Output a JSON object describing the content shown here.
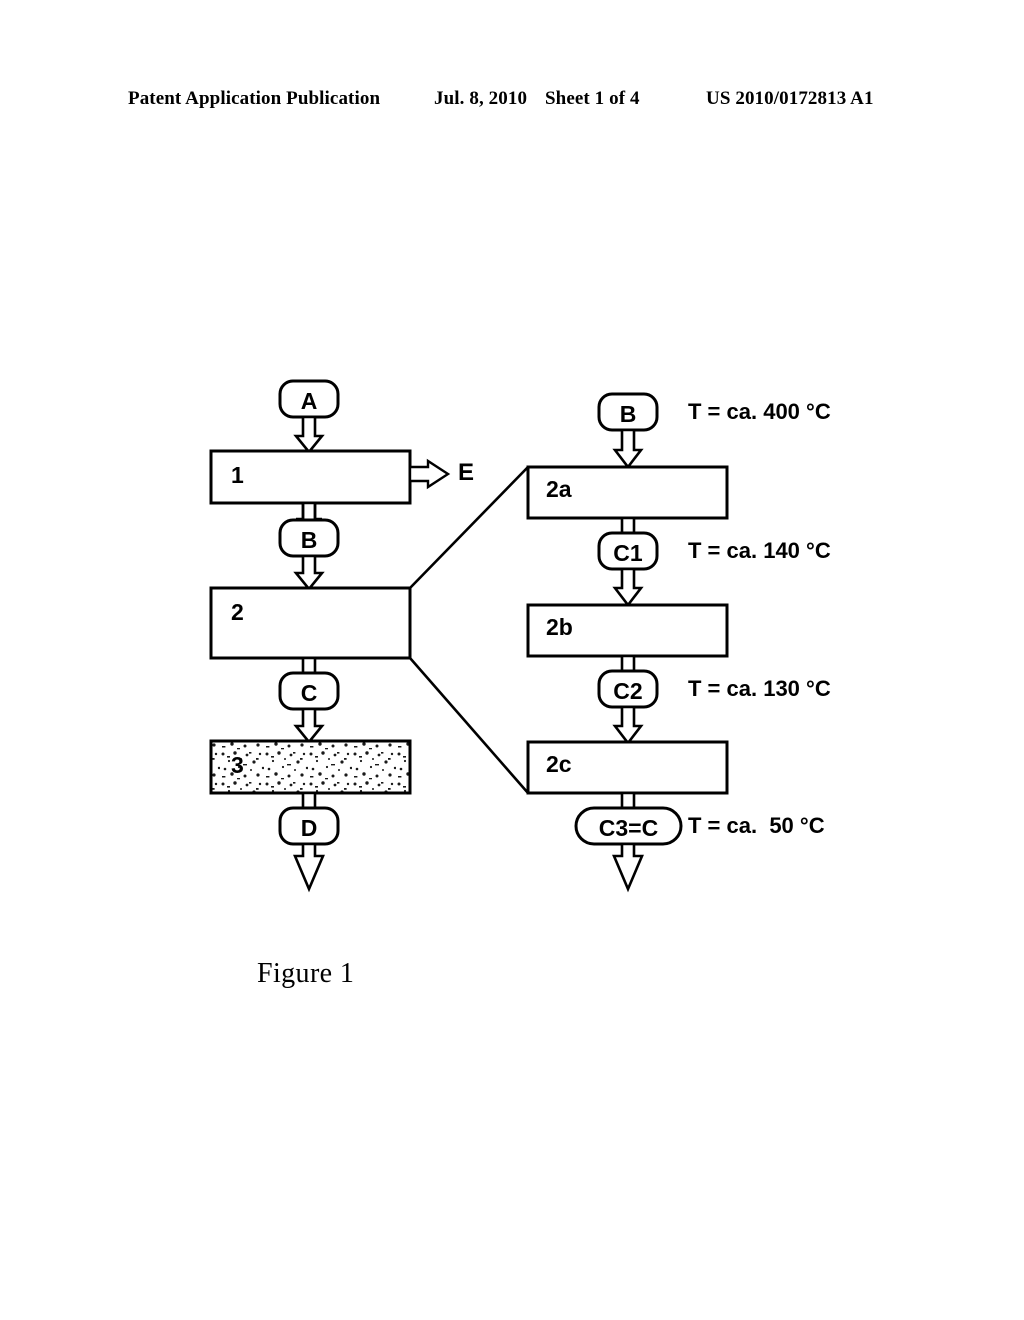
{
  "header": {
    "publication": "Patent Application Publication",
    "date": "Jul. 8, 2010",
    "sheet": "Sheet 1 of 4",
    "number": "US 2010/0172813 A1"
  },
  "figure": {
    "caption": "Figure 1",
    "left_column": {
      "nodes": [
        {
          "id": "A",
          "label": "A"
        },
        {
          "id": "B",
          "label": "B"
        },
        {
          "id": "C",
          "label": "C"
        },
        {
          "id": "D",
          "label": "D"
        }
      ],
      "boxes": [
        {
          "id": "1",
          "label": "1",
          "fill": "white"
        },
        {
          "id": "2",
          "label": "2",
          "fill": "white"
        },
        {
          "id": "3",
          "label": "3",
          "fill": "stippled"
        }
      ],
      "side_stream": {
        "label": "E"
      }
    },
    "right_column": {
      "nodes": [
        {
          "id": "B",
          "label": "B",
          "temperature": "T = ca. 400 °C"
        },
        {
          "id": "C1",
          "label": "C1",
          "temperature": "T = ca. 140 °C"
        },
        {
          "id": "C2",
          "label": "C2",
          "temperature": "T = ca. 130 °C"
        },
        {
          "id": "C3",
          "label": "C3=C",
          "temperature": "T = ca.  50 °C"
        }
      ],
      "boxes": [
        {
          "id": "2a",
          "label": "2a"
        },
        {
          "id": "2b",
          "label": "2b"
        },
        {
          "id": "2c",
          "label": "2c"
        }
      ]
    }
  },
  "colors": {
    "line": "#000000",
    "page_background": "#ffffff",
    "box_fill": "#ffffff"
  }
}
